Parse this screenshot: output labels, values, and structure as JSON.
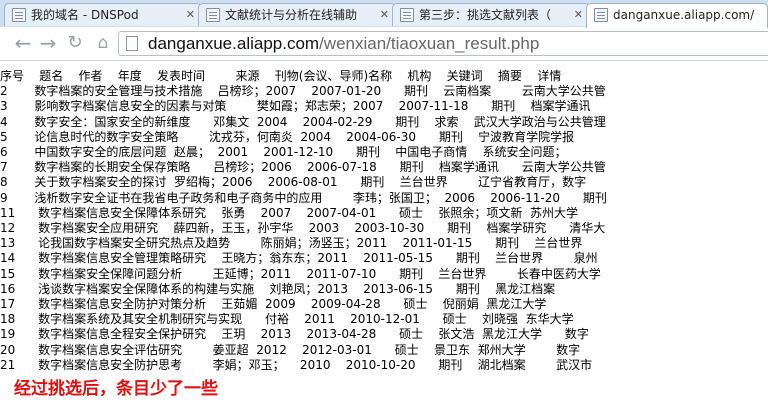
{
  "tabs": [
    {
      "title": "我的域名 - DNSPod",
      "active": false
    },
    {
      "title": "文献统计与分析在线辅助",
      "active": false
    },
    {
      "title": "第三步：挑选文献列表（",
      "active": false
    },
    {
      "title": "danganxue.aliapp.com/",
      "active": true
    }
  ],
  "address_bar": {
    "host": "danganxue.aliapp.com",
    "path": "/wenxian/tiaoxuan_result.php"
  },
  "table": {
    "header": "序号    题名    作者    年度    发表时间        来源    刊物(会议、导师)名称    机构    关键词    摘要    详情",
    "rows": [
      "2       数字档案的安全管理与技术措施    吕榜珍；2007    2007-01-20      期刊    云南档案        云南大学公共管",
      "3       影响数字档案信息安全的因素与对策        樊如霞；郑志荣；2007    2007-11-18      期刊    档案学通讯",
      "4       数字安全：国家安全的新维度      邓集文  2004    2004-02-29      期刊    求索    武汉大学政治与公共管理",
      "5       论信息时代的数字安全策略        沈戎芬，何南炎  2004    2004-06-30      期刊    宁波教育学院学报",
      "6       中国数字安全的底层问题  赵晨；  2001    2001-12-10      期刊    中国电子商情    系统安全问题；",
      "7       数字档案的长期安全保存策略      吕榜珍；2006    2006-07-18      期刊    档案学通讯      云南大学公共管",
      "8       关于数字档案安全的探讨  罗绍梅；2006    2006-08-01      期刊    兰台世界        辽宁省教育厅，数字",
      "9       浅析数字安全证书在我省电子政务和电子商务中的应用        李玮；张国卫；  2006    2006-11-20      期刊",
      "11      数字档案信息安全保障体系研究    张勇    2007    2007-04-01      硕士    张照余；项文新  苏州大学",
      "12      数字档案安全应用研究    薛四新，王玉，孙宇华    2003    2003-10-30      期刊    档案学研究      清华大",
      "13      论我国数字档案安全研究热点及趋势        陈丽娟；汤竖玉；2011    2011-01-15      期刊    兰台世界",
      "14      数字档案信息安全管理策略研究    王晓方；翁东东；2011    2011-05-15      期刊    兰台世界        泉州",
      "15      数字档案安全保障问题分析        王延博；2011    2011-07-10      期刊    兰台世界        长春中医药大学",
      "16      浅谈数字档案安全保障体系的构建与实施    刘艳凤；2013    2013-06-15      期刊    黑龙江档案",
      "17      数字档案信息安全防护对策分析    王茹媚  2009    2009-04-28      硕士    倪丽娟  黑龙江大学",
      "18      数字档案系统及其安全机制研究与实现      付裕    2011    2010-12-01      硕士    刘晓强  东华大学",
      "19      数字档案信息全程安全保护研究    王玥    2013    2013-04-28      硕士    张文浩  黑龙江大学      数字",
      "20      数字档案信息安全评估研究        姜亚超  2012    2012-03-01      硕士    景卫东  郑州大学        数字",
      "21      数字档案信息安全防护思考        李娟；邓玉；    2010    2010-10-20      期刊    湖北档案        武汉市"
    ]
  },
  "note": "经过挑选后，条目少了一些",
  "colors": {
    "note": "#e01010",
    "tabstrip": "#cfdff2"
  }
}
